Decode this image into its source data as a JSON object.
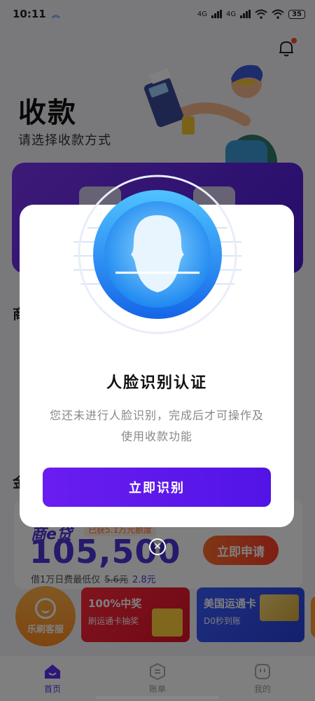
{
  "status_bar": {
    "time": "10:11",
    "network1": "4G",
    "network2": "4G",
    "battery": "35"
  },
  "header": {
    "title": "收款",
    "subtitle": "请选择收款方式"
  },
  "sections": {
    "label1": "商",
    "label2": "金"
  },
  "loan": {
    "brand": "商e贷",
    "promo": "已获5.1万元额度",
    "amount": "105,500",
    "rate_prefix": "借1万日费最低仅",
    "rate_old": "5.6元",
    "rate_new": "2.8元",
    "apply_label": "立即申请"
  },
  "promos": {
    "customer_service": "乐刷客服",
    "banner1_title": "100%中奖",
    "banner1_sub": "刷运通卡抽奖",
    "banner2_title": "美国运通卡",
    "banner2_sub": "D0秒到账"
  },
  "tabs": [
    {
      "label": "首页"
    },
    {
      "label": "账单"
    },
    {
      "label": "我的"
    }
  ],
  "dialog": {
    "title": "人脸识别认证",
    "message": "您还未进行人脸识别，完成后才可操作及使用收款功能",
    "button": "立即识别"
  },
  "colors": {
    "primary_purple": "#5a2ff0",
    "apply_orange": "#ff4a2a",
    "face_blue": "#2196f3"
  }
}
